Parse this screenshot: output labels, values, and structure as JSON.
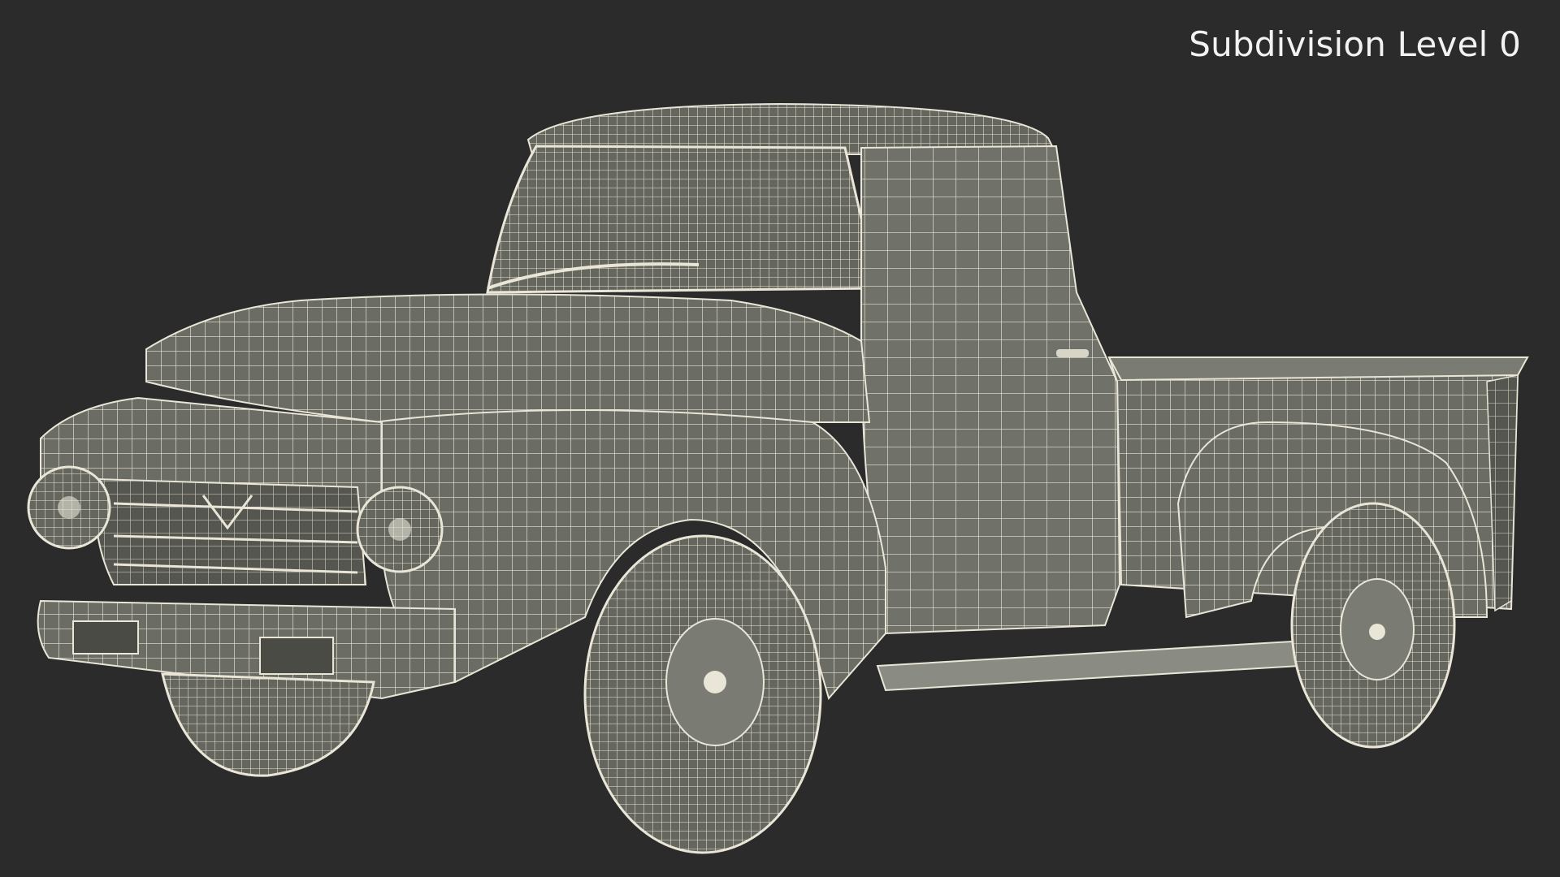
{
  "overlay": {
    "subdivision_label": "Subdivision Level 0"
  },
  "render": {
    "subject": "pickup-truck-wireframe",
    "background_color": "#2b2b2b",
    "surface_color": "#6b6c64",
    "wire_color": "#e9e6d8",
    "shadow_color": "#4a4b45"
  }
}
